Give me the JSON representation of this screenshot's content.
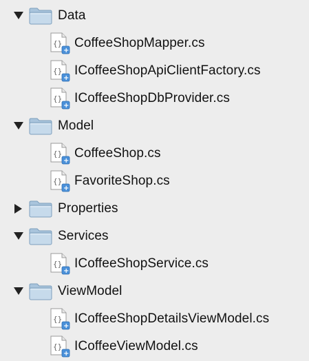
{
  "tree": {
    "items": [
      {
        "kind": "folder",
        "label": "Data",
        "expanded": true,
        "icon": "folder-icon"
      },
      {
        "kind": "file",
        "label": "CoffeeShopMapper.cs",
        "icon": "csharp-file-icon"
      },
      {
        "kind": "file",
        "label": "ICoffeeShopApiClientFactory.cs",
        "icon": "csharp-file-icon"
      },
      {
        "kind": "file",
        "label": "ICoffeeShopDbProvider.cs",
        "icon": "csharp-file-icon"
      },
      {
        "kind": "folder",
        "label": "Model",
        "expanded": true,
        "icon": "folder-icon"
      },
      {
        "kind": "file",
        "label": "CoffeeShop.cs",
        "icon": "csharp-file-icon"
      },
      {
        "kind": "file",
        "label": "FavoriteShop.cs",
        "icon": "csharp-file-icon"
      },
      {
        "kind": "folder",
        "label": "Properties",
        "expanded": false,
        "icon": "folder-icon"
      },
      {
        "kind": "folder",
        "label": "Services",
        "expanded": true,
        "icon": "folder-icon"
      },
      {
        "kind": "file",
        "label": "ICoffeeShopService.cs",
        "icon": "csharp-file-icon"
      },
      {
        "kind": "folder",
        "label": "ViewModel",
        "expanded": true,
        "icon": "folder-icon"
      },
      {
        "kind": "file",
        "label": "ICoffeeShopDetailsViewModel.cs",
        "icon": "csharp-file-icon"
      },
      {
        "kind": "file",
        "label": "ICoffeeViewModel.cs",
        "icon": "csharp-file-icon"
      }
    ]
  },
  "colors": {
    "background": "#ededed",
    "folder_light": "#c9dcec",
    "folder_dark": "#8fb1cf",
    "file_badge": "#4a90d9"
  }
}
